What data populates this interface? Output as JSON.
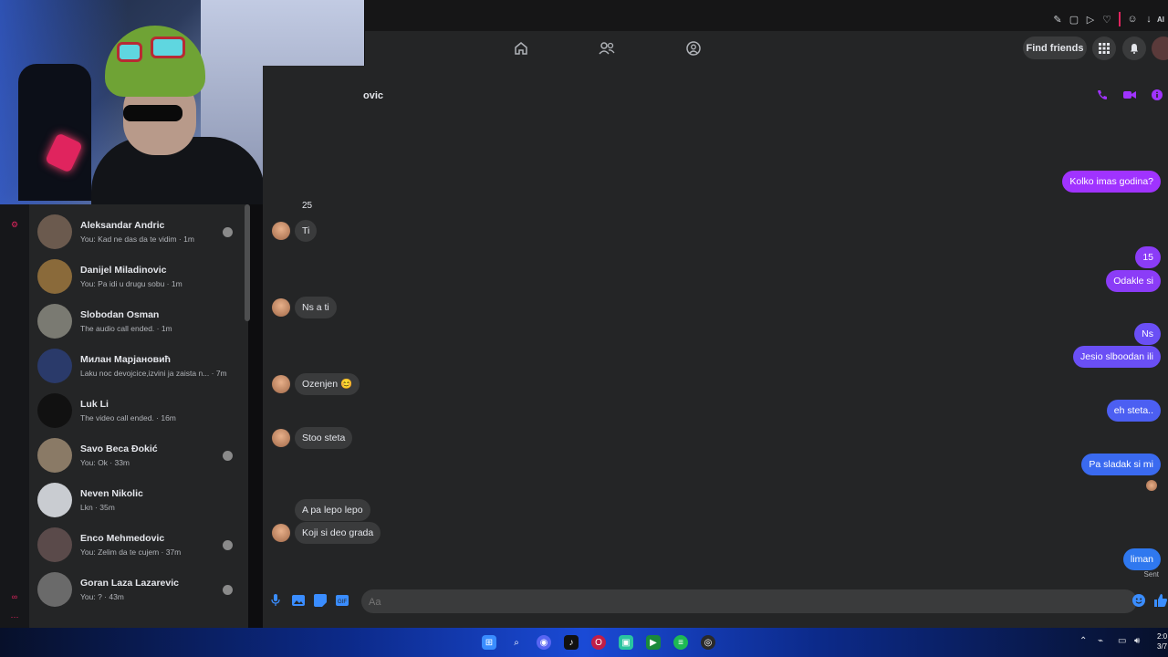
{
  "browser": {
    "tab_label": "AI"
  },
  "fbnav": {
    "find_friends": "Find friends"
  },
  "conversation": {
    "contact_name_fragment": "ovic",
    "fragment_25": "25",
    "messages": [
      {
        "dir": "out",
        "text": "Kolko imas godina?",
        "color": "#a033ff"
      },
      {
        "dir": "in",
        "text": "Ti"
      },
      {
        "dir": "out",
        "text": "15",
        "color": "#8b3cf7"
      },
      {
        "dir": "out",
        "text": "Odakle si",
        "color": "#8b3cf7"
      },
      {
        "dir": "in",
        "text": "Ns a ti"
      },
      {
        "dir": "out",
        "text": "Ns",
        "color": "#6a4ff5"
      },
      {
        "dir": "out",
        "text": "Jesio slboodan ili",
        "color": "#6a4ff5"
      },
      {
        "dir": "in",
        "text": "Ozenjen 😊"
      },
      {
        "dir": "out",
        "text": "eh steta..",
        "color": "#4c5ff2"
      },
      {
        "dir": "in",
        "text": "Stoo steta"
      },
      {
        "dir": "out",
        "text": "Pa sladak si mi",
        "color": "#3a6af0"
      },
      {
        "dir": "in",
        "text": "A pa lepo lepo"
      },
      {
        "dir": "in",
        "text": "Koji si deo grada"
      },
      {
        "dir": "out",
        "text": "liman",
        "color": "#2f78ef"
      }
    ],
    "sent_label": "Sent",
    "composer_placeholder": "Aa"
  },
  "chats": [
    {
      "name": "Aleksandar Andric",
      "preview": "You: Kad ne das da te vidim · 1m",
      "color": "#6b5a4e"
    },
    {
      "name": "Danijel Miladinovic",
      "preview": "You: Pa idi u drugu sobu · 1m",
      "color": "#8a6a3a"
    },
    {
      "name": "Slobodan Osman",
      "preview": "The audio call ended. · 1m",
      "color": "#7a7a72"
    },
    {
      "name": "Милан Марјановић",
      "preview": "Laku noc devojcice,izvini ja zaista n... · 7m",
      "color": "#2a3a6a"
    },
    {
      "name": "Luk Li",
      "preview": "The video call ended. · 16m",
      "color": "#111111"
    },
    {
      "name": "Savo Beca Đokić",
      "preview": "You: Ok · 33m",
      "color": "#8a7a66"
    },
    {
      "name": "Neven Nikolic",
      "preview": "Lkn · 35m",
      "color": "#c9ccd1"
    },
    {
      "name": "Enco Mehmedovic",
      "preview": "You: Zelim da te cujem · 37m",
      "color": "#5a4a4a"
    },
    {
      "name": "Goran Laza Lazarevic",
      "preview": "You: ? · 43m",
      "color": "#6a6a6a"
    }
  ],
  "taskbar": {
    "clock_time": "2:0",
    "clock_date": "3/7"
  },
  "colors": {
    "accent": "#a033ff",
    "messenger_blue": "#3a8dff",
    "surface": "#242526",
    "bubble_in": "#3a3b3c"
  }
}
